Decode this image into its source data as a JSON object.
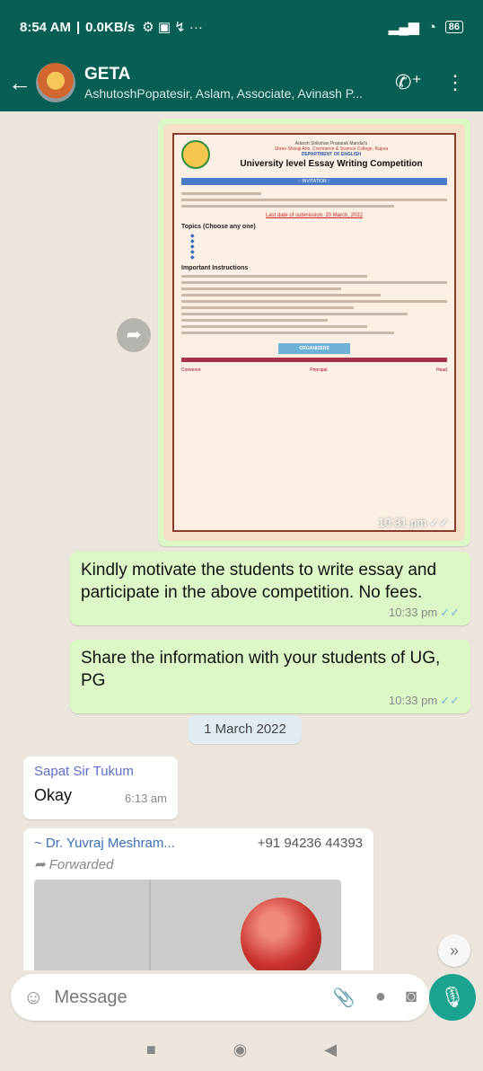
{
  "status_bar": {
    "time": "8:54 AM",
    "speed": "0.0KB/s",
    "battery": "86"
  },
  "header": {
    "back": "←",
    "title": "GETA",
    "subtitle": "AshutoshPopatesir, Aslam, Associate, Avinash P...",
    "icons": [
      "add-call-icon",
      "more-vert-icon"
    ]
  },
  "messages": {
    "poster": {
      "org": "Adarsh Shikshan Prasarak Mandal's",
      "college": "Shree Shivaji Arts, Commerce & Science College, Rajura",
      "dept": "DEPARTMENT OF ENGLISH",
      "title": "University level Essay Writing Competition",
      "banner": ":: INVITATION ::",
      "deadline": "Last date of submission: 20 March, 2022",
      "topics_heading": "Topics (Choose any one)",
      "instructions_heading": "Important Instructions",
      "organizers": "ORGANIZERS",
      "signatories": [
        "Convenor",
        "Principal",
        "Head"
      ],
      "time": "10:31 pm"
    },
    "out1": {
      "text": "Kindly motivate the students to write essay and participate in the above competition. No fees.",
      "time": "10:33 pm"
    },
    "out2": {
      "text": "Share the information with your students of UG, PG",
      "time": "10:33 pm"
    },
    "date_separator": "1 March 2022",
    "in1": {
      "sender": "Sapat Sir Tukum",
      "text": "Okay",
      "time": "6:13 am"
    },
    "in2": {
      "sender": "~ Dr. Yuvraj Meshram...",
      "phone": "+91 94236 44393",
      "forwarded": "Forwarded"
    }
  },
  "composer": {
    "placeholder": "Message"
  }
}
